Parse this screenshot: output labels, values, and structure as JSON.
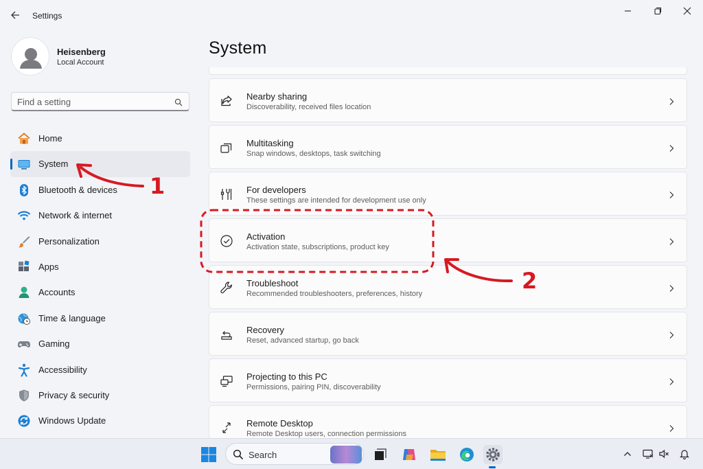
{
  "window": {
    "app_title": "Settings",
    "controls": [
      "minimize",
      "restore",
      "close"
    ]
  },
  "profile": {
    "name": "Heisenberg",
    "account_type": "Local Account"
  },
  "search": {
    "placeholder": "Find a setting"
  },
  "sidebar": {
    "items": [
      {
        "label": "Home",
        "icon": "home-icon",
        "active": false
      },
      {
        "label": "System",
        "icon": "system-icon",
        "active": true
      },
      {
        "label": "Bluetooth & devices",
        "icon": "bluetooth-icon",
        "active": false
      },
      {
        "label": "Network & internet",
        "icon": "wifi-icon",
        "active": false
      },
      {
        "label": "Personalization",
        "icon": "brush-icon",
        "active": false
      },
      {
        "label": "Apps",
        "icon": "apps-icon",
        "active": false
      },
      {
        "label": "Accounts",
        "icon": "accounts-icon",
        "active": false
      },
      {
        "label": "Time & language",
        "icon": "globe-clock-icon",
        "active": false
      },
      {
        "label": "Gaming",
        "icon": "gamepad-icon",
        "active": false
      },
      {
        "label": "Accessibility",
        "icon": "accessibility-icon",
        "active": false
      },
      {
        "label": "Privacy & security",
        "icon": "shield-icon",
        "active": false
      },
      {
        "label": "Windows Update",
        "icon": "update-icon",
        "active": false
      }
    ]
  },
  "main": {
    "title": "System",
    "cards": [
      {
        "title": "Nearby sharing",
        "desc": "Discoverability, received files location",
        "icon": "share-icon"
      },
      {
        "title": "Multitasking",
        "desc": "Snap windows, desktops, task switching",
        "icon": "multitask-icon"
      },
      {
        "title": "For developers",
        "desc": "These settings are intended for development use only",
        "icon": "developer-tools-icon"
      },
      {
        "title": "Activation",
        "desc": "Activation state, subscriptions, product key",
        "icon": "check-circle-icon"
      },
      {
        "title": "Troubleshoot",
        "desc": "Recommended troubleshooters, preferences, history",
        "icon": "wrench-icon"
      },
      {
        "title": "Recovery",
        "desc": "Reset, advanced startup, go back",
        "icon": "recovery-icon"
      },
      {
        "title": "Projecting to this PC",
        "desc": "Permissions, pairing PIN, discoverability",
        "icon": "projecting-icon"
      },
      {
        "title": "Remote Desktop",
        "desc": "Remote Desktop users, connection permissions",
        "icon": "remote-desktop-icon"
      }
    ]
  },
  "annotations": {
    "step1": "1",
    "step2": "2",
    "color": "#d71921"
  },
  "taskbar": {
    "search_label": "Search",
    "apps": [
      "start-icon",
      "task-view-icon",
      "copilot-icon",
      "file-explorer-icon",
      "edge-icon",
      "settings-icon"
    ],
    "tray": [
      "chevron-up-icon",
      "network-monitor-icon",
      "volume-muted-icon",
      "bell-icon"
    ]
  },
  "colors": {
    "accent": "#0067c0",
    "window_bg": "#f3f4f8",
    "card_bg": "#fbfbfc"
  }
}
